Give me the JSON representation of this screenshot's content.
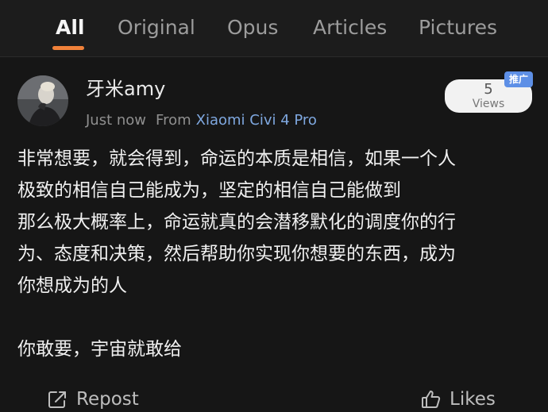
{
  "tabs": [
    {
      "label": "All",
      "active": true
    },
    {
      "label": "Original",
      "active": false
    },
    {
      "label": "Opus",
      "active": false
    },
    {
      "label": "Articles",
      "active": false
    },
    {
      "label": "Pictures",
      "active": false
    }
  ],
  "colors": {
    "background": "#161616",
    "active_underline": "#f0813a",
    "device_link": "#7fa8e0",
    "promo_tag": "#5d8fe6"
  },
  "post": {
    "author": "牙米amy",
    "time": "Just now",
    "from_label": "From",
    "device": "Xiaomi Civi 4 Pro",
    "views_count": "5",
    "views_label": "Views",
    "promo_tag": "推广",
    "body_lines": [
      "非常想要，就会得到，命运的本质是相信，如果一个人",
      "极致的相信自己能成为，坚定的相信自己能做到",
      "那么极大概率上，命运就真的会潜移默化的调度你的行",
      "为、态度和决策，然后帮助你实现你想要的东西，成为",
      "你想成为的人",
      "",
      "你敢要，宇宙就敢给"
    ]
  },
  "actions": {
    "repost_label": "Repost",
    "repost_icon": "share-box-icon",
    "likes_label": "Likes",
    "likes_icon": "thumbs-up-icon"
  }
}
